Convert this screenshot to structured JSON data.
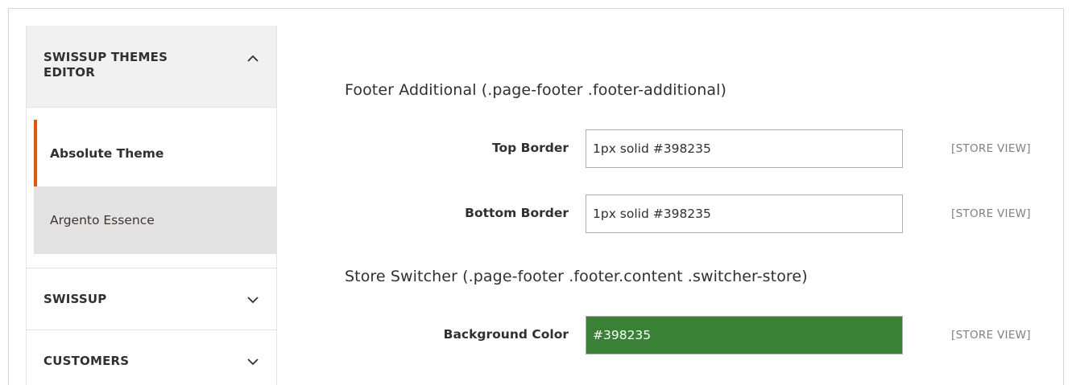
{
  "sidebar": {
    "sections": [
      {
        "title_line1": "SWISSUP THEMES",
        "title_line2": "EDITOR",
        "expanded": true,
        "icon": "chevron-up-icon",
        "items": [
          {
            "label": "Absolute Theme",
            "active": true
          },
          {
            "label": "Argento Essence",
            "active": false
          }
        ]
      },
      {
        "title": "SWISSUP",
        "expanded": false,
        "icon": "chevron-down-icon"
      },
      {
        "title": "CUSTOMERS",
        "expanded": false,
        "icon": "chevron-down-icon"
      }
    ]
  },
  "main": {
    "groups": [
      {
        "title": "Footer Additional (.page-footer .footer-additional)",
        "fields": [
          {
            "label": "Top Border",
            "value": "1px solid #398235",
            "scope": "[STORE VIEW]"
          },
          {
            "label": "Bottom Border",
            "value": "1px solid #398235",
            "scope": "[STORE VIEW]"
          }
        ]
      },
      {
        "title": "Store Switcher (.page-footer .footer.content .switcher-store)",
        "fields": [
          {
            "label": "Background Color",
            "value": "#398235",
            "scope": "[STORE VIEW]",
            "swatch": "#398235"
          }
        ]
      }
    ]
  },
  "colors": {
    "accent": "#eb5202",
    "swatch_green": "#398235"
  }
}
